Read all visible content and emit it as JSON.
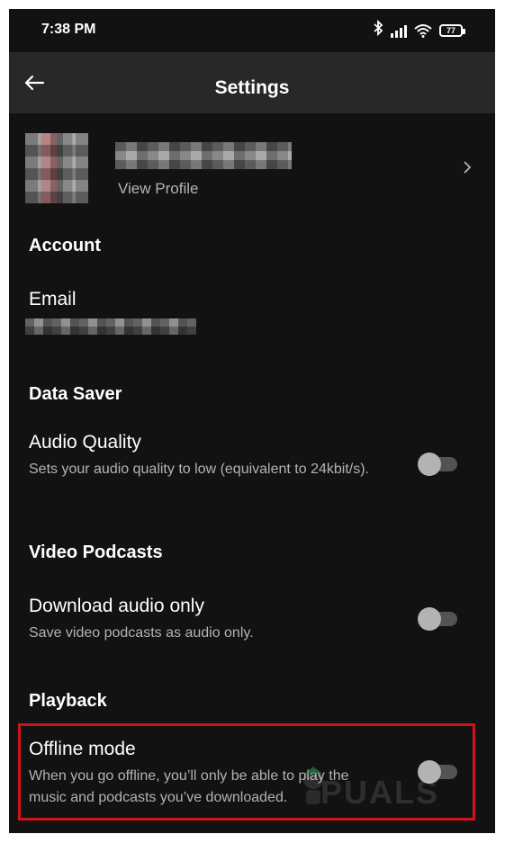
{
  "status_bar": {
    "time": "7:38 PM",
    "battery": "77",
    "icons": [
      "bluetooth-icon",
      "signal-icon",
      "wifi-icon",
      "battery-icon"
    ]
  },
  "header": {
    "title": "Settings",
    "back_icon": "arrow-left-icon"
  },
  "profile": {
    "view_profile_label": "View Profile",
    "name_obscured": true
  },
  "sections": {
    "account": {
      "title": "Account",
      "email_label": "Email",
      "email_obscured": true
    },
    "data_saver": {
      "title": "Data Saver",
      "audio_quality": {
        "label": "Audio Quality",
        "description": "Sets your audio quality to low (equivalent to 24kbit/s).",
        "enabled": false
      }
    },
    "video_podcasts": {
      "title": "Video Podcasts",
      "download_audio_only": {
        "label": "Download audio only",
        "description": "Save video podcasts as audio only.",
        "enabled": false
      }
    },
    "playback": {
      "title": "Playback",
      "offline_mode": {
        "label": "Offline mode",
        "description": "When you go offline, you’ll only be able to play the music and podcasts you’ve downloaded.",
        "enabled": false,
        "highlighted": true
      }
    }
  },
  "watermark": "PUALS",
  "colors": {
    "background": "#121212",
    "header_bg": "#282828",
    "text_primary": "#ffffff",
    "text_secondary": "#b3b3b3",
    "toggle_track": "#535353",
    "toggle_knob": "#b3b3b3",
    "highlight": "#d0121b"
  }
}
